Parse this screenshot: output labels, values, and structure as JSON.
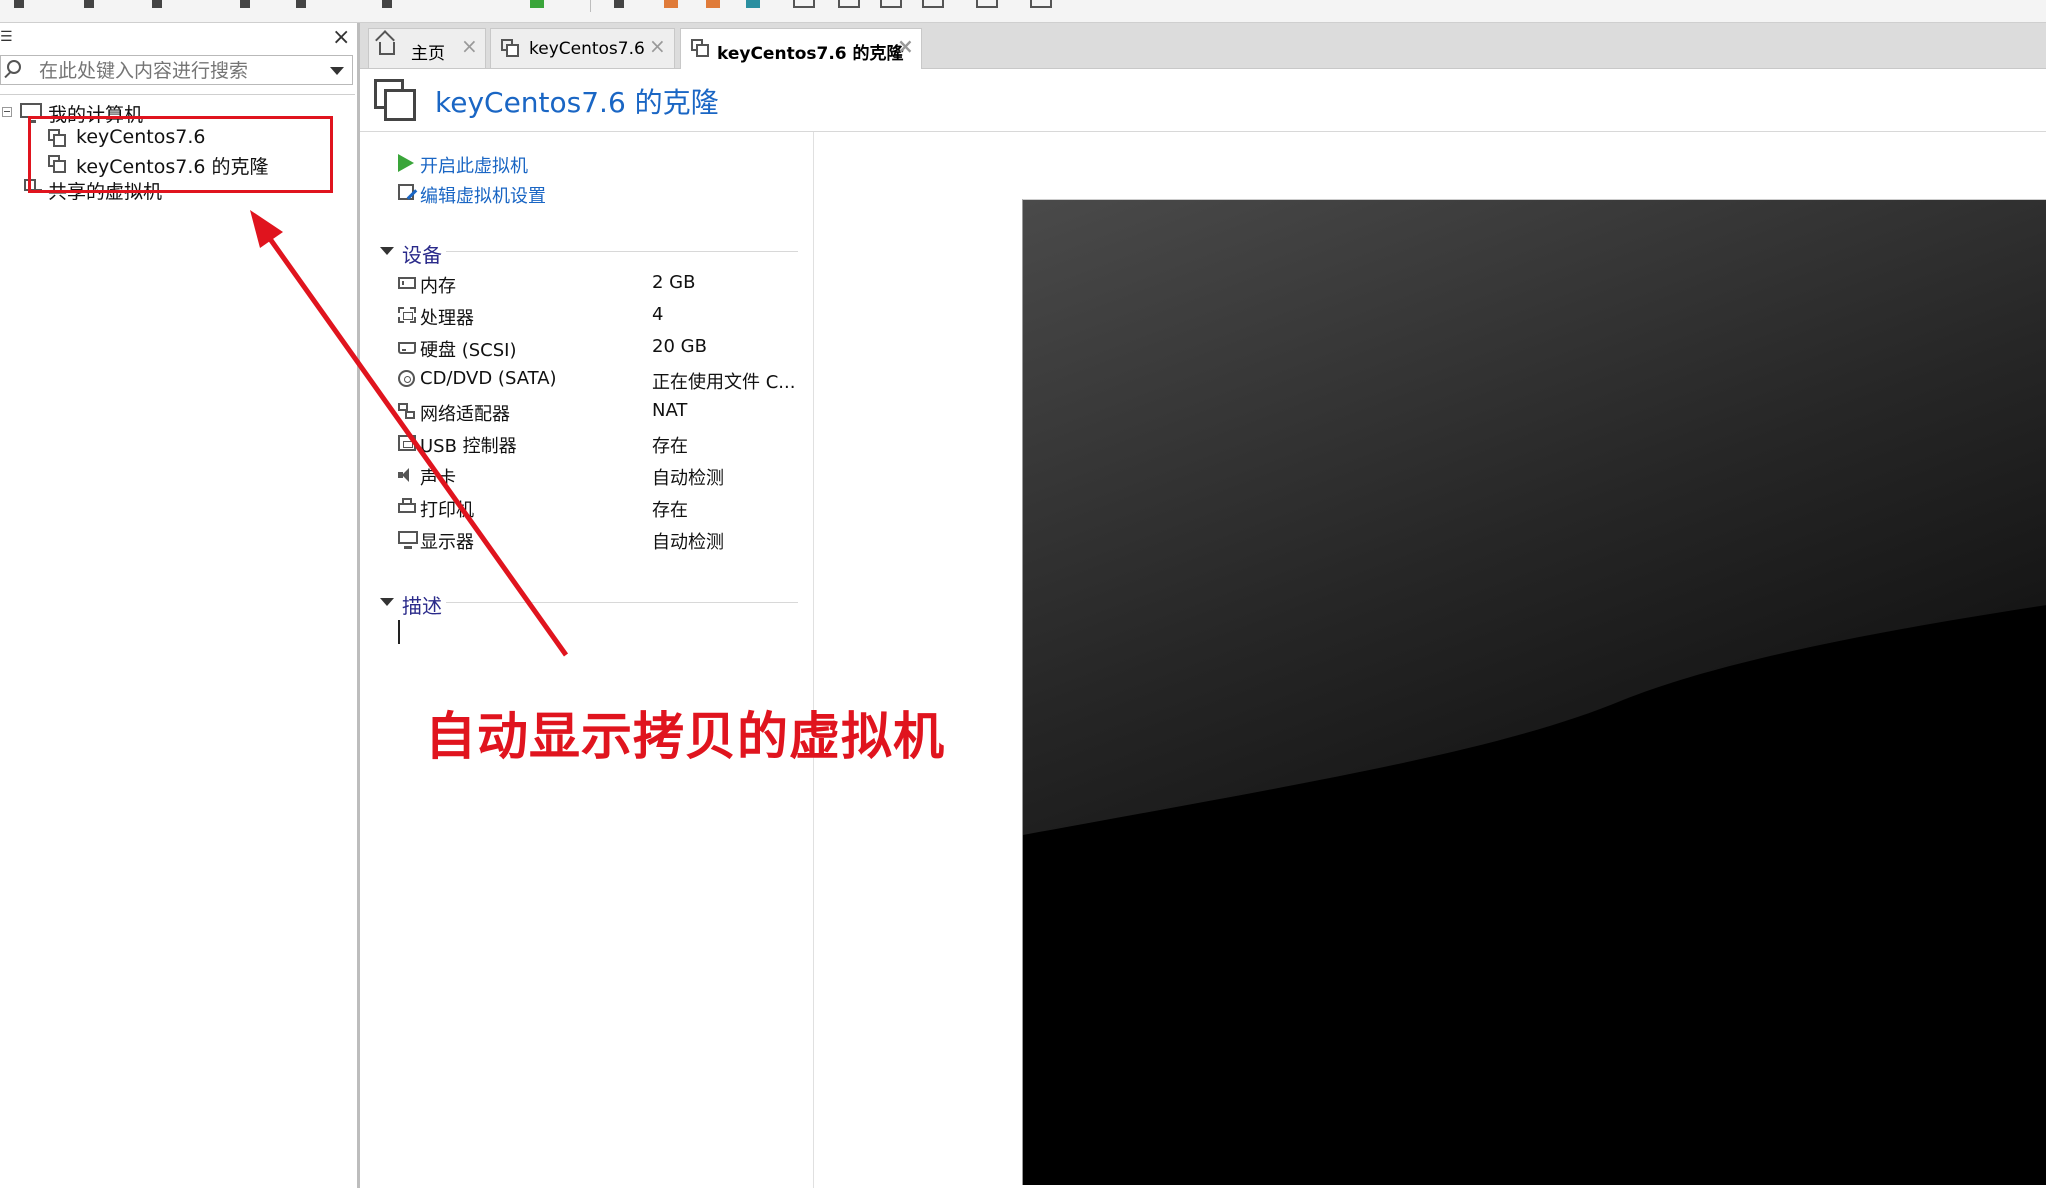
{
  "library": {
    "menu_glyph": "☰",
    "close_glyph": "×",
    "search_placeholder": "在此处键入内容进行搜索",
    "tree": {
      "my_computer": "我的计算机",
      "vms": [
        "keyCentos7.6",
        "keyCentos7.6 的克隆"
      ],
      "shared_vms": "共享的虚拟机"
    }
  },
  "tabs": [
    {
      "label": "主页",
      "icon": "home-icon"
    },
    {
      "label": "keyCentos7.6",
      "icon": "vm-icon"
    },
    {
      "label": "keyCentos7.6 的克隆",
      "icon": "vm-icon",
      "active": true
    }
  ],
  "tab_close_glyph": "×",
  "vm": {
    "title": "keyCentos7.6 的克隆",
    "actions": {
      "power_on": "开启此虚拟机",
      "edit_settings": "编辑虚拟机设置"
    },
    "devices_header": "设备",
    "devices": [
      {
        "name": "内存",
        "value": "2 GB",
        "icon": "memory-icon"
      },
      {
        "name": "处理器",
        "value": "4",
        "icon": "cpu-icon"
      },
      {
        "name": "硬盘 (SCSI)",
        "value": "20 GB",
        "icon": "disk-icon"
      },
      {
        "name": "CD/DVD (SATA)",
        "value": "正在使用文件 C...",
        "icon": "cd-icon"
      },
      {
        "name": "网络适配器",
        "value": "NAT",
        "icon": "net-icon"
      },
      {
        "name": "USB 控制器",
        "value": "存在",
        "icon": "usb-icon"
      },
      {
        "name": "声卡",
        "value": "自动检测",
        "icon": "sound-icon"
      },
      {
        "name": "打印机",
        "value": "存在",
        "icon": "printer-icon"
      },
      {
        "name": "显示器",
        "value": "自动检测",
        "icon": "display-icon"
      }
    ],
    "description_header": "描述"
  },
  "annotation": {
    "text": "自动显示拷贝的虚拟机",
    "color": "#e0141e"
  },
  "colors": {
    "link_blue": "#1a66c4",
    "section_text": "#2a2a8a",
    "play_green": "#3aa53a"
  }
}
